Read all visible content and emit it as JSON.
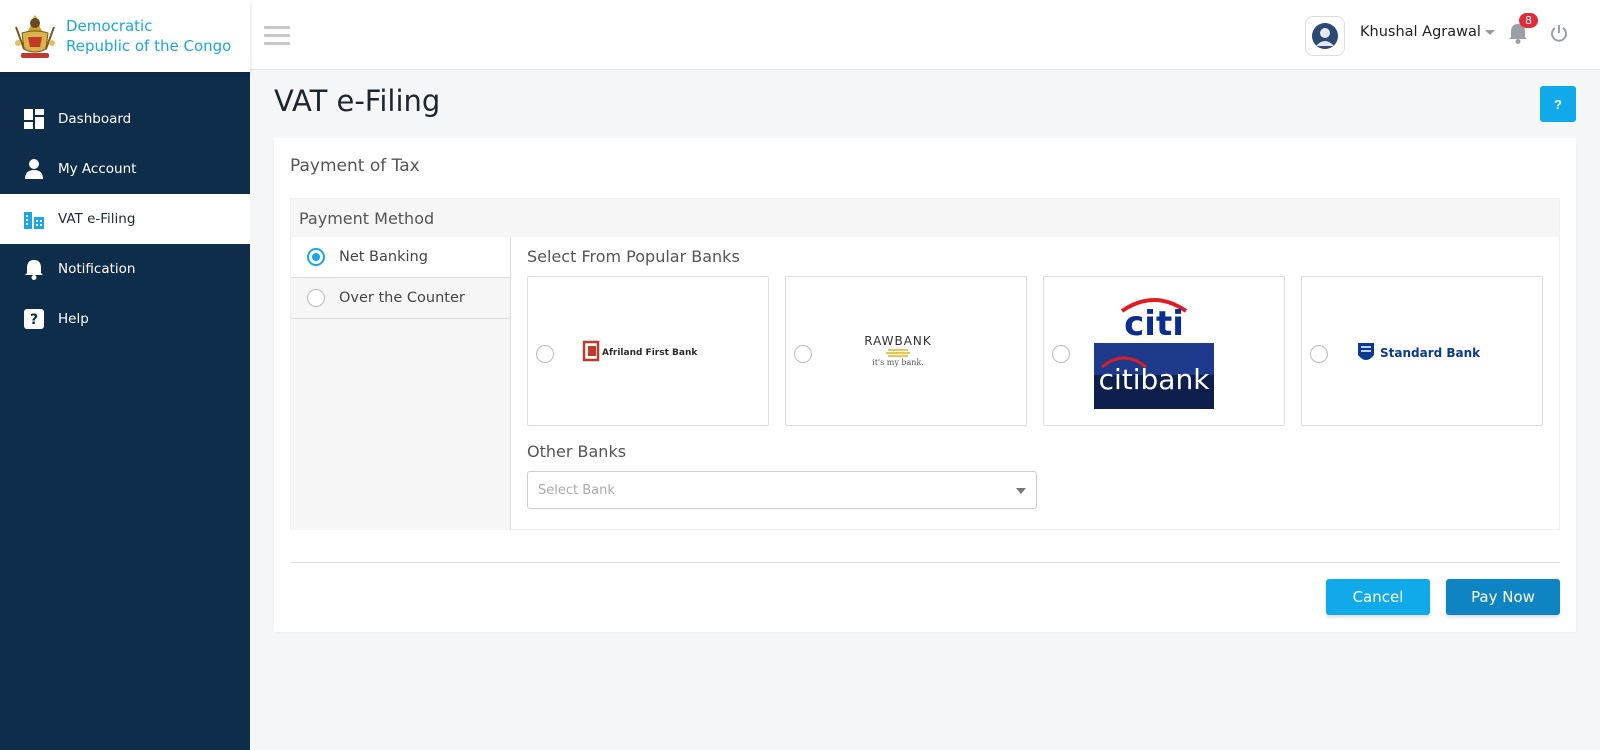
{
  "brand": {
    "line1": "Democratic",
    "line2": "Republic of the Congo"
  },
  "sidebar": {
    "items": [
      {
        "label": "Dashboard",
        "icon": "dashboard-icon"
      },
      {
        "label": "My Account",
        "icon": "user-icon"
      },
      {
        "label": "VAT e-Filing",
        "icon": "building-icon",
        "active": true
      },
      {
        "label": "Notification",
        "icon": "bell-icon"
      },
      {
        "label": "Help",
        "icon": "question-icon"
      }
    ]
  },
  "topbar": {
    "user_name": "Khushal Agrawal",
    "notification_count": "8"
  },
  "page": {
    "title": "VAT e-Filing",
    "help_label": "?"
  },
  "card": {
    "title": "Payment of Tax",
    "payment_method_label": "Payment Method",
    "tabs": [
      {
        "label": "Net Banking",
        "selected": true
      },
      {
        "label": "Over the Counter",
        "selected": false
      }
    ],
    "popular_banks_label": "Select From Popular Banks",
    "banks": [
      {
        "name": "Afriland First Bank"
      },
      {
        "name": "RAWBANK",
        "tagline": "it's my bank."
      },
      {
        "name": "citi",
        "sub": "citibank"
      },
      {
        "name": "Standard Bank"
      }
    ],
    "other_banks_label": "Other Banks",
    "select_placeholder": "Select Bank",
    "cancel_label": "Cancel",
    "pay_label": "Pay Now"
  },
  "colors": {
    "sidebar_bg": "#0e2d4b",
    "accent": "#1aa6e4",
    "pay_button": "#0e84c2",
    "badge": "#e12c3c"
  }
}
